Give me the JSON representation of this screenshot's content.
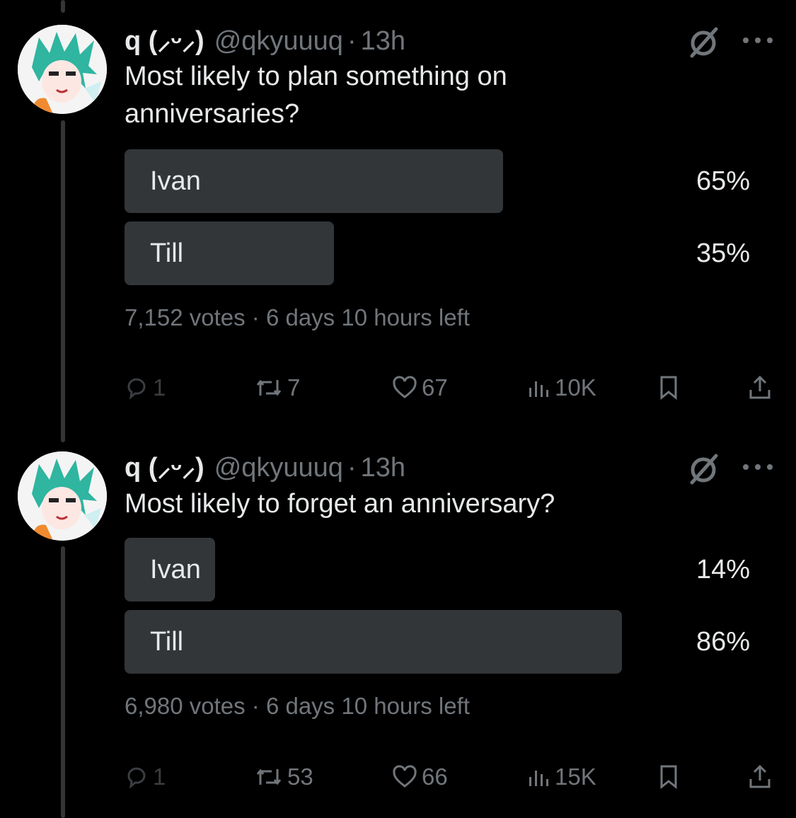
{
  "tweets": [
    {
      "name": "q (⸝ᵕ⸝)",
      "handle": "@qkyuuuq",
      "dot": "·",
      "time": "13h",
      "text": "Most likely to plan something on anniversaries?",
      "poll": {
        "options": [
          {
            "label": "Ivan",
            "percent": 65,
            "percent_text": "65%"
          },
          {
            "label": "Till",
            "percent": 35,
            "percent_text": "35%"
          }
        ],
        "meta": "7,152 votes · 6 days 10 hours left"
      },
      "actions": {
        "replies": "1",
        "reposts": "7",
        "likes": "67",
        "views": "10K"
      }
    },
    {
      "name": "q (⸝ᵕ⸝)",
      "handle": "@qkyuuuq",
      "dot": "·",
      "time": "13h",
      "text": "Most likely to forget an anniversary?",
      "poll": {
        "options": [
          {
            "label": "Ivan",
            "percent": 14,
            "percent_text": "14%"
          },
          {
            "label": "Till",
            "percent": 86,
            "percent_text": "86%"
          }
        ],
        "meta": "6,980 votes · 6 days 10 hours left"
      },
      "actions": {
        "replies": "1",
        "reposts": "53",
        "likes": "66",
        "views": "15K"
      }
    }
  ],
  "icons": {
    "grok": "grok-icon",
    "more": "more-icon",
    "reply": "reply-icon",
    "repost": "repost-icon",
    "like": "heart-icon",
    "views": "views-icon",
    "bookmark": "bookmark-icon",
    "share": "share-icon"
  },
  "colors": {
    "background": "#000000",
    "text": "#e7e9ea",
    "muted": "#71767b",
    "poll_bar": "#333639",
    "avatar_hair": "#2fb5a0"
  }
}
